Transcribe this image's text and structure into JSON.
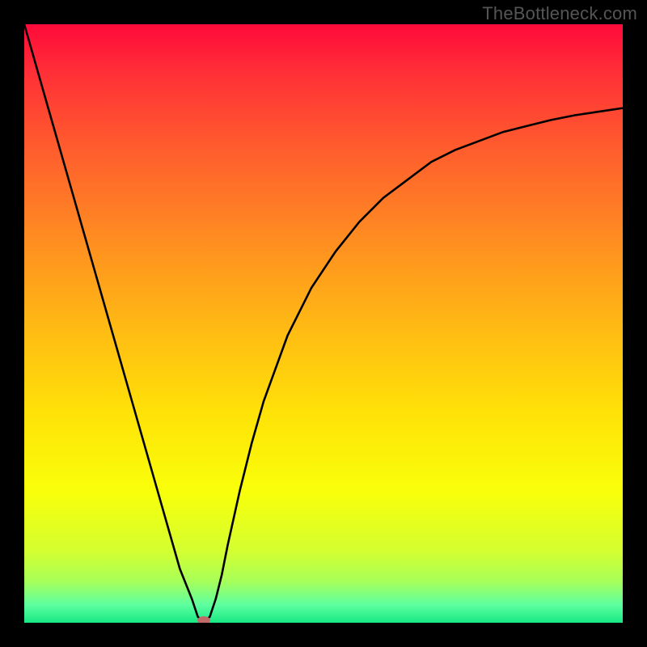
{
  "watermark": "TheBottleneck.com",
  "chart_data": {
    "type": "line",
    "title": "",
    "xlabel": "",
    "ylabel": "",
    "xlim": [
      0,
      100
    ],
    "ylim": [
      0,
      100
    ],
    "curve": {
      "x": [
        0,
        2,
        4,
        6,
        8,
        10,
        12,
        14,
        16,
        18,
        20,
        22,
        24,
        26,
        28,
        29,
        30,
        31,
        32,
        33,
        34,
        36,
        38,
        40,
        44,
        48,
        52,
        56,
        60,
        64,
        68,
        72,
        76,
        80,
        84,
        88,
        92,
        96,
        100
      ],
      "y": [
        100,
        93,
        86,
        79,
        72,
        65,
        58,
        51,
        44,
        37,
        30,
        23,
        16,
        9,
        4,
        1,
        0,
        1,
        4,
        8,
        13,
        22,
        30,
        37,
        48,
        56,
        62,
        67,
        71,
        74,
        77,
        79,
        80.5,
        82,
        83,
        84,
        84.8,
        85.4,
        86
      ]
    },
    "marker": {
      "x": 30,
      "y": 0,
      "color": "#c06a6a"
    },
    "gradient_stops": [
      {
        "offset": 0.0,
        "color": "#ff0a3a"
      },
      {
        "offset": 0.08,
        "color": "#ff2f37"
      },
      {
        "offset": 0.2,
        "color": "#ff5a2e"
      },
      {
        "offset": 0.35,
        "color": "#ff8a22"
      },
      {
        "offset": 0.5,
        "color": "#ffb814"
      },
      {
        "offset": 0.65,
        "color": "#ffe208"
      },
      {
        "offset": 0.78,
        "color": "#f9ff0a"
      },
      {
        "offset": 0.88,
        "color": "#d4ff30"
      },
      {
        "offset": 0.93,
        "color": "#a8ff58"
      },
      {
        "offset": 0.97,
        "color": "#5effa0"
      },
      {
        "offset": 1.0,
        "color": "#17e884"
      }
    ]
  }
}
